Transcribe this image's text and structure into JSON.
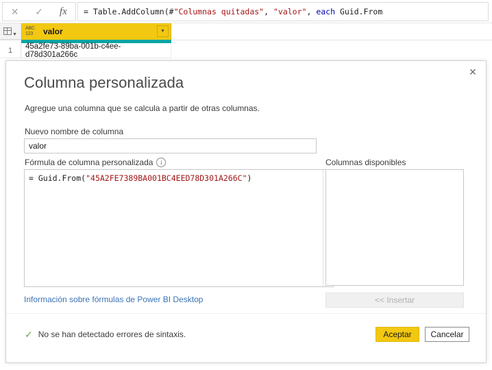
{
  "formula_bar": {
    "cancel_icon": "close-icon",
    "accept_icon": "check-icon",
    "fx_label": "fx",
    "formula_prefix": "= Table.AddColumn(#",
    "formula_arg1": "\"Columnas quitadas\"",
    "formula_comma1": ", ",
    "formula_arg2": "\"valor\"",
    "formula_comma2": ", ",
    "formula_keyword": "each",
    "formula_tail": " Guid.From"
  },
  "grid": {
    "corner_icon": "table-select-icon",
    "column": {
      "type_icon_top": "ABC",
      "type_icon_bottom": "123",
      "name": "valor",
      "dropdown_icon": "chevron-down-icon"
    },
    "rows": [
      {
        "number": "1",
        "value": "45a2fe73-89ba-001b-c4ee-d78d301a266c"
      }
    ],
    "colors": {
      "header": "#f2c811",
      "quality_bar": "#01a5a3"
    }
  },
  "dialog": {
    "close_icon": "close-icon",
    "title": "Columna personalizada",
    "subtitle": "Agregue una columna que se calcula a partir de otras columnas.",
    "new_name": {
      "label": "Nuevo nombre de columna",
      "value": "valor",
      "placeholder": ""
    },
    "formula": {
      "label": "Fórmula de columna personalizada",
      "info_icon": "info-icon",
      "value_prefix": "= Guid.From(",
      "value_string": "\"45A2FE7389BA001BC4EED78D301A266C\"",
      "value_suffix": ")"
    },
    "available_columns": {
      "label": "Columnas disponibles",
      "items": [],
      "insert_button": "<< Insertar"
    },
    "help_link": "Información sobre fórmulas de Power BI Desktop",
    "status": {
      "icon": "check-icon",
      "text": "No se han detectado errores de sintaxis.",
      "color": "#6aa84f"
    },
    "buttons": {
      "accept": "Aceptar",
      "cancel": "Cancelar"
    }
  }
}
